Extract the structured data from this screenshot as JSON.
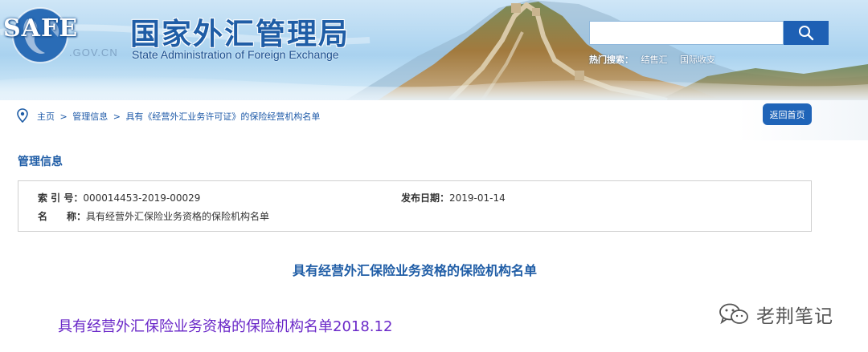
{
  "header": {
    "logo_text": "SAFE",
    "domain_text": ".GOV.CN",
    "site_title": "国家外汇管理局",
    "site_subtitle": "State Administration of Foreign Exchange",
    "search": {
      "value": "",
      "placeholder": ""
    },
    "hot_search": {
      "label": "热门搜索：",
      "keywords": [
        "结售汇",
        "国际收支"
      ]
    }
  },
  "breadcrumb": {
    "items": [
      "主页",
      "管理信息",
      "具有《经营外汇业务许可证》的保险经营机构名单"
    ],
    "separator": ">"
  },
  "back_button_label": "返回首页",
  "section": {
    "title": "管理信息",
    "info": {
      "index_label": "索 引 号：",
      "index_value": "000014453-2019-00029",
      "date_label": "发布日期：",
      "date_value": "2019-01-14",
      "name_label": "名　　称：",
      "name_value": "具有经营外汇保险业务资格的保险机构名单"
    }
  },
  "document": {
    "title": "具有经营外汇保险业务资格的保险机构名单",
    "attachment_link": "具有经营外汇保险业务资格的保险机构名单2018.12"
  },
  "watermark": {
    "text": "老荆笔记"
  },
  "colors": {
    "brand_blue": "#1f5da6",
    "button_blue": "#1f64b8",
    "link_purple": "#6a28c8"
  }
}
